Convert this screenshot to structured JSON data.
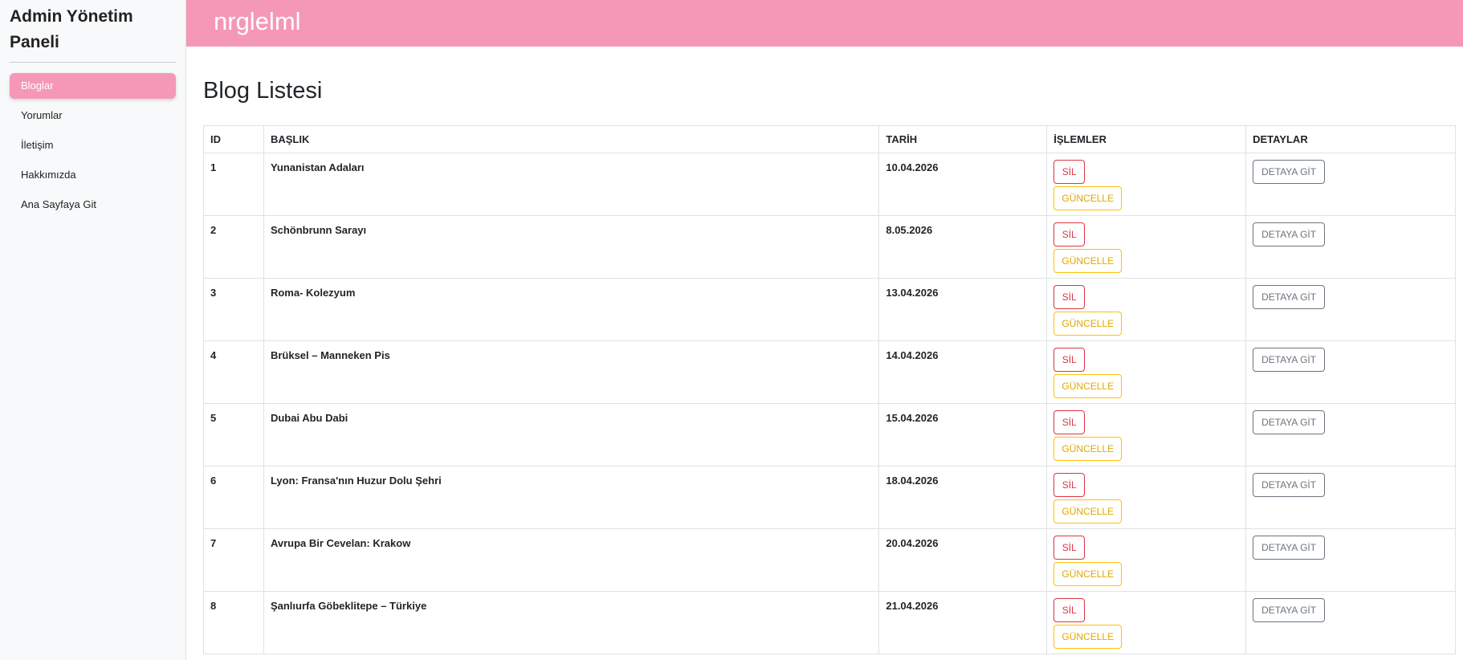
{
  "sidebar": {
    "brand": "Admin Yönetim Paneli",
    "items": [
      {
        "label": "Bloglar",
        "active": true
      },
      {
        "label": "Yorumlar",
        "active": false
      },
      {
        "label": "İletişim",
        "active": false
      },
      {
        "label": "Hakkımızda",
        "active": false
      },
      {
        "label": "Ana Sayfaya Git",
        "active": false
      }
    ]
  },
  "topbar": {
    "title": "nrglelml"
  },
  "main": {
    "heading": "Blog Listesi",
    "columns": [
      "ID",
      "BAŞLIK",
      "TARİH",
      "İŞLEMLER",
      "DETAYLAR"
    ],
    "buttons": {
      "delete": "SİL",
      "update": "GÜNCELLE",
      "detail": "DETAYA GİT"
    },
    "rows": [
      {
        "id": "1",
        "title": "Yunanistan Adaları",
        "date": "10.04.2026"
      },
      {
        "id": "2",
        "title": "Schönbrunn Sarayı",
        "date": "8.05.2026"
      },
      {
        "id": "3",
        "title": "Roma- Kolezyum",
        "date": "13.04.2026"
      },
      {
        "id": "4",
        "title": "Brüksel – Manneken Pis",
        "date": "14.04.2026"
      },
      {
        "id": "5",
        "title": "Dubai Abu Dabi",
        "date": "15.04.2026"
      },
      {
        "id": "6",
        "title": "Lyon: Fransa'nın Huzur Dolu Şehri",
        "date": "18.04.2026"
      },
      {
        "id": "7",
        "title": "Avrupa Bir Cevelan: Krakow",
        "date": "20.04.2026"
      },
      {
        "id": "8",
        "title": "Şanlıurfa Göbeklitepe – Türkiye",
        "date": "21.04.2026"
      }
    ]
  },
  "colors": {
    "accent": "#f598b7",
    "danger": "#dc3545",
    "warning": "#ffc107",
    "secondary": "#6c757d"
  }
}
